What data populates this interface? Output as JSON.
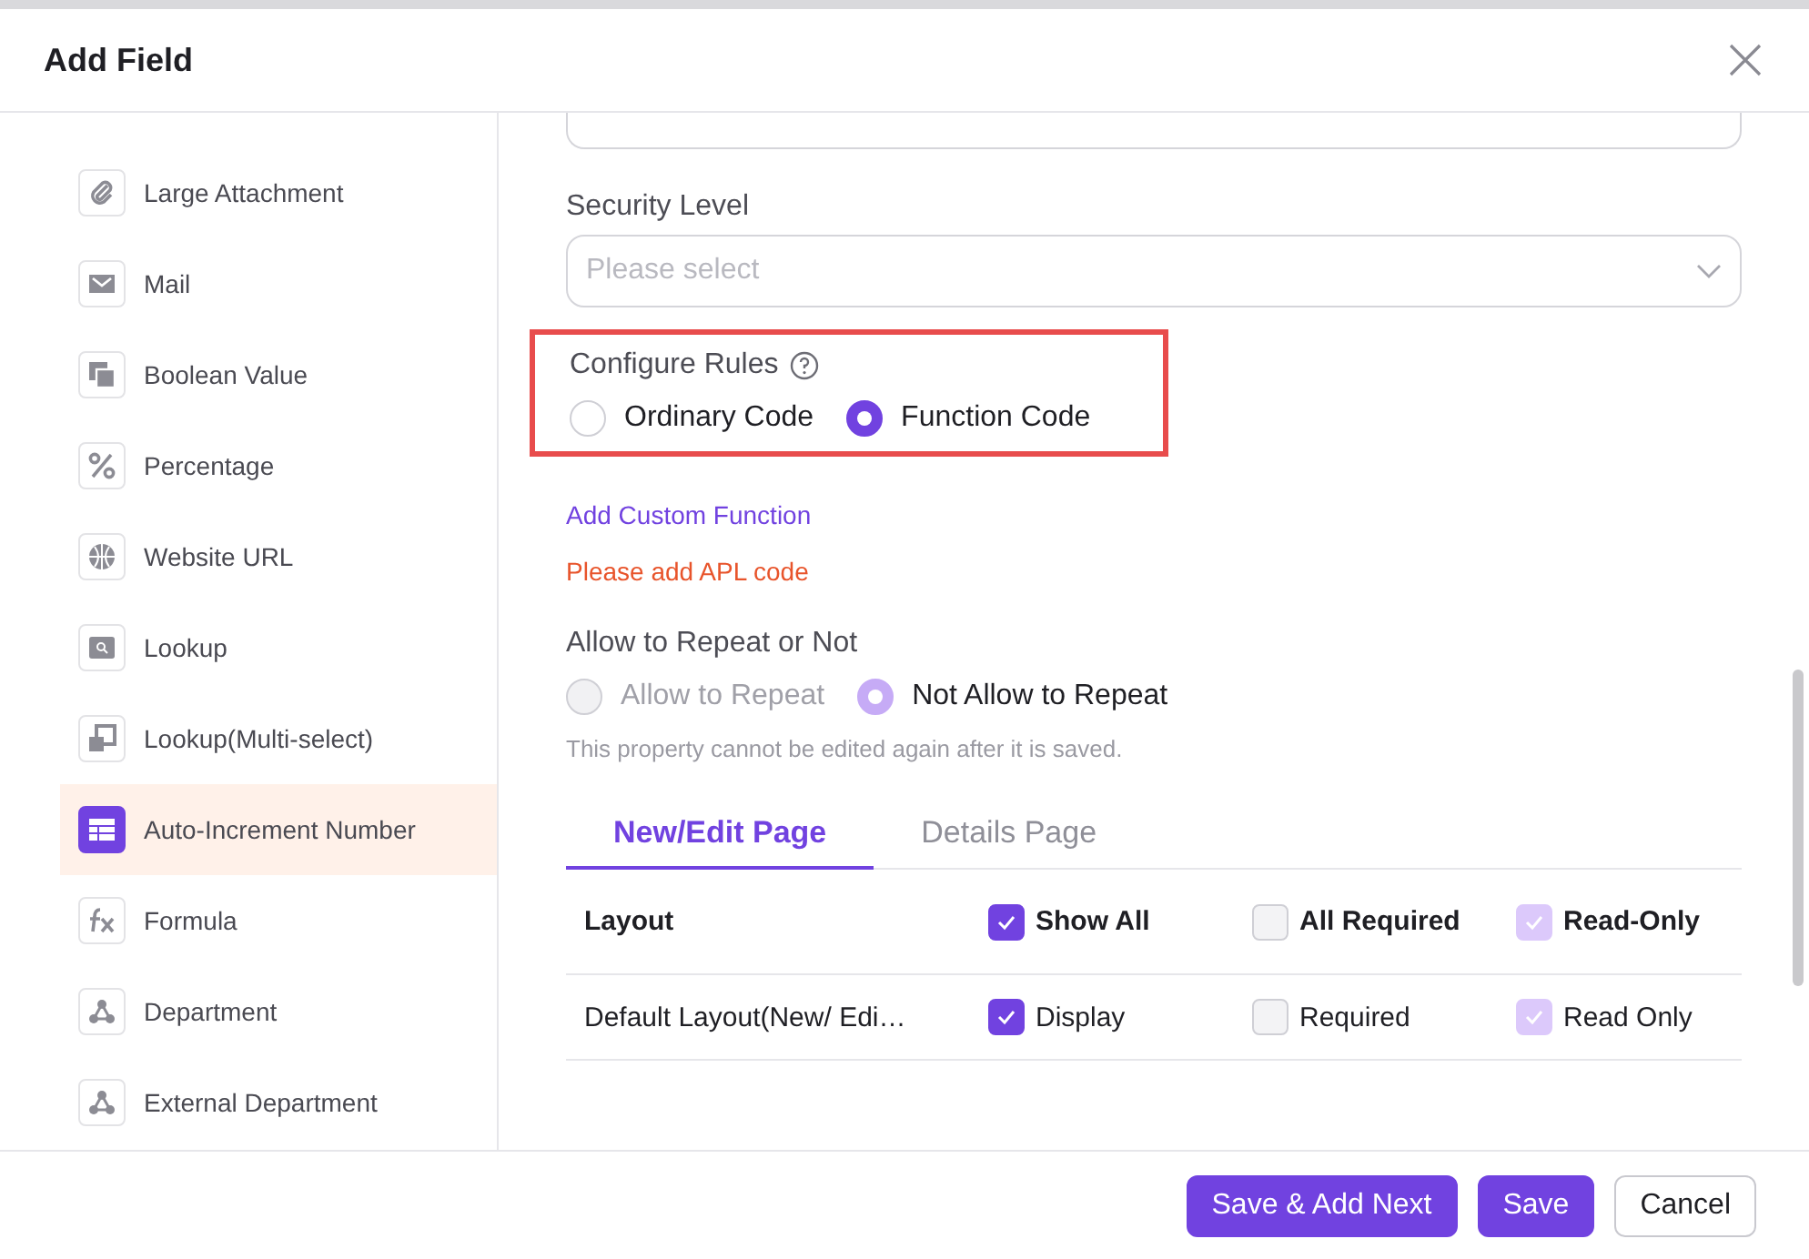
{
  "dialog": {
    "title": "Add Field"
  },
  "sidebar": {
    "items": [
      {
        "label": "Large Attachment",
        "kind": "paperclip",
        "selected": false
      },
      {
        "label": "Mail",
        "kind": "mail",
        "selected": false
      },
      {
        "label": "Boolean Value",
        "kind": "squares",
        "selected": false
      },
      {
        "label": "Percentage",
        "kind": "percent",
        "selected": false
      },
      {
        "label": "Website URL",
        "kind": "globe",
        "selected": false
      },
      {
        "label": "Lookup",
        "kind": "lookup",
        "selected": false
      },
      {
        "label": "Lookup(Multi-select)",
        "kind": "multi",
        "selected": false
      },
      {
        "label": "Auto-Increment Number",
        "kind": "table",
        "selected": true
      },
      {
        "label": "Formula",
        "kind": "fx",
        "selected": false
      },
      {
        "label": "Department",
        "kind": "dept",
        "selected": false
      },
      {
        "label": "External Department",
        "kind": "dept",
        "selected": false
      }
    ]
  },
  "security_level": {
    "label": "Security Level",
    "placeholder": "Please select"
  },
  "configure_rules": {
    "label": "Configure Rules",
    "highlighted": true,
    "options": [
      {
        "label": "Ordinary Code",
        "selected": false,
        "disabled": false
      },
      {
        "label": "Function Code",
        "selected": true,
        "disabled": false
      }
    ]
  },
  "add_custom_function": "Add Custom Function",
  "error": "Please add APL code",
  "repeat": {
    "label": "Allow to Repeat or Not",
    "options": [
      {
        "label": "Allow to Repeat",
        "selected": false,
        "disabled": true
      },
      {
        "label": "Not Allow to Repeat",
        "selected": true,
        "disabled": true
      }
    ],
    "hint": "This property cannot be edited again after it is saved."
  },
  "tabs": [
    {
      "label": "New/Edit Page",
      "selected": true
    },
    {
      "label": "Details Page",
      "selected": false
    }
  ],
  "table": {
    "header": {
      "layout": "Layout",
      "cells": [
        {
          "label": "Show All",
          "checked": true,
          "disabled": false
        },
        {
          "label": "All Required",
          "checked": false,
          "disabled": false
        },
        {
          "label": "Read-Only",
          "checked": true,
          "disabled": true
        }
      ]
    },
    "rows": [
      {
        "layout": "Default Layout(New/ Edi…",
        "cells": [
          {
            "label": "Display",
            "checked": true,
            "disabled": false
          },
          {
            "label": "Required",
            "checked": false,
            "disabled": false
          },
          {
            "label": "Read Only",
            "checked": true,
            "disabled": true
          }
        ]
      }
    ]
  },
  "buttons": [
    {
      "label": "Save & Add Next",
      "kind": "primary"
    },
    {
      "label": "Save",
      "kind": "primary"
    },
    {
      "label": "Cancel",
      "kind": "secondary"
    }
  ]
}
